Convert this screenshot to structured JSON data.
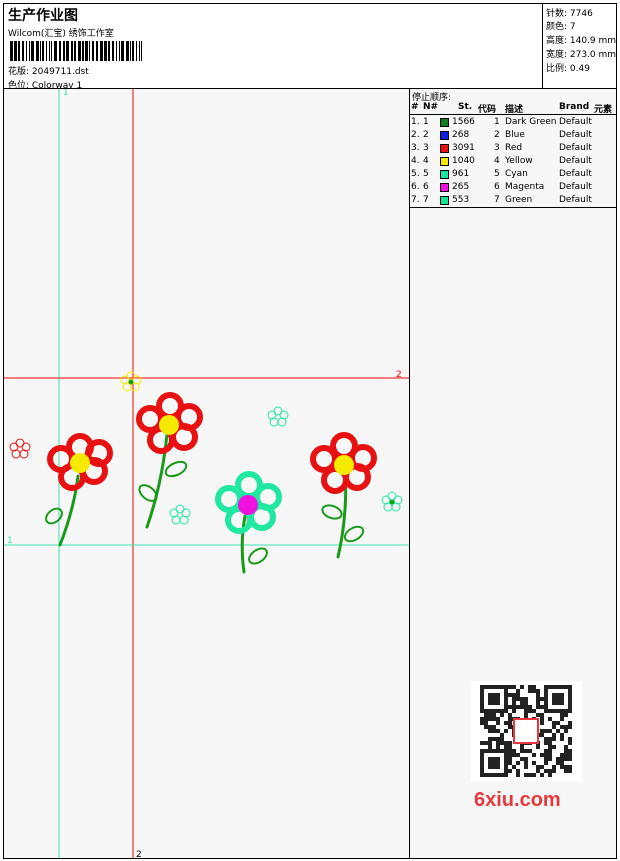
{
  "header": {
    "title": "生产作业图",
    "company": "Wilcom(汇宝) 绣饰工作室",
    "design_label": "花版: 2049711.dst",
    "colorway_label": "色位: Colorway 1"
  },
  "stats": {
    "stitches": "针数: 7746",
    "colors": "颜色: 7",
    "height": "高度: 140.9 mm",
    "width": "宽度: 273.0 mm",
    "scale": "比例: 0.49"
  },
  "guides": {
    "h1": "1",
    "h2": "2",
    "v1": "1",
    "v2": "2"
  },
  "stop_sequence": {
    "title": "停止顺序:",
    "headers": {
      "index": "#",
      "no": "N#",
      "stitches": "St.",
      "code": "代码",
      "description": "描述",
      "brand": "Brand",
      "element": "元素"
    },
    "rows": [
      {
        "index": "1.",
        "no": "1",
        "color": "#0f7f1f",
        "stitches": "1566",
        "code": "1",
        "description": "Dark Green",
        "brand": "Default"
      },
      {
        "index": "2.",
        "no": "2",
        "color": "#0a1ee6",
        "stitches": "268",
        "code": "2",
        "description": "Blue",
        "brand": "Default"
      },
      {
        "index": "3.",
        "no": "3",
        "color": "#e81010",
        "stitches": "3091",
        "code": "3",
        "description": "Red",
        "brand": "Default"
      },
      {
        "index": "4.",
        "no": "4",
        "color": "#f5ea00",
        "stitches": "1040",
        "code": "4",
        "description": "Yellow",
        "brand": "Default"
      },
      {
        "index": "5.",
        "no": "5",
        "color": "#16e6a0",
        "stitches": "961",
        "code": "5",
        "description": "Cyan",
        "brand": "Default"
      },
      {
        "index": "6.",
        "no": "6",
        "color": "#f010e0",
        "stitches": "265",
        "code": "6",
        "description": "Magenta",
        "brand": "Default"
      },
      {
        "index": "7.",
        "no": "7",
        "color": "#10e890",
        "stitches": "553",
        "code": "7",
        "description": "Green",
        "brand": "Default"
      }
    ]
  },
  "watermark": "6xiu.com",
  "colors": {
    "guide_red": "#ff0000",
    "guide_cyan": "#3fe0b0",
    "petal_red": "#e81010",
    "center_yellow": "#f5ea00",
    "stem_green": "#1a9a1a",
    "petal_mint": "#20e8a0",
    "center_magenta": "#f010e0"
  }
}
